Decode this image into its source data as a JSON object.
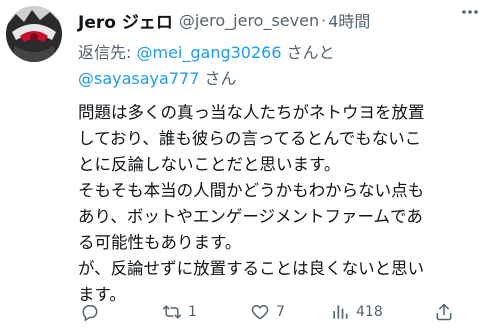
{
  "author": {
    "display_name": "Jero ジェロ",
    "handle": "@jero_jero_seven",
    "separator": "·",
    "time": "4時間"
  },
  "reply_to": {
    "prefix": "返信先: ",
    "mention1": "@mei_gang30266",
    "suffix1": " さんと",
    "mention2": "@sayasaya777",
    "suffix2": " さん"
  },
  "tweet_text": "問題は多くの真っ当な人たちがネトウヨを放置\nしており、誰も彼らの言ってるとんでもないこ\nとに反論しないことだと思います。\nそもそも本当の人間かどうかもわからない点も\nあり、ボットやエンゲージメントファームであ\nる可能性もあります。\nが、反論せずに放置することは良くないと思い\nます。",
  "actions": {
    "replies": "",
    "retweets": "1",
    "likes": "7",
    "views": "418"
  },
  "icons": {
    "reply": "reply-icon",
    "retweet": "retweet-icon",
    "like": "heart-icon",
    "views": "views-icon",
    "share": "share-icon",
    "more": "more-icon"
  },
  "colors": {
    "text": "#0f1419",
    "secondary": "#536471",
    "link": "#1d9bf0"
  }
}
